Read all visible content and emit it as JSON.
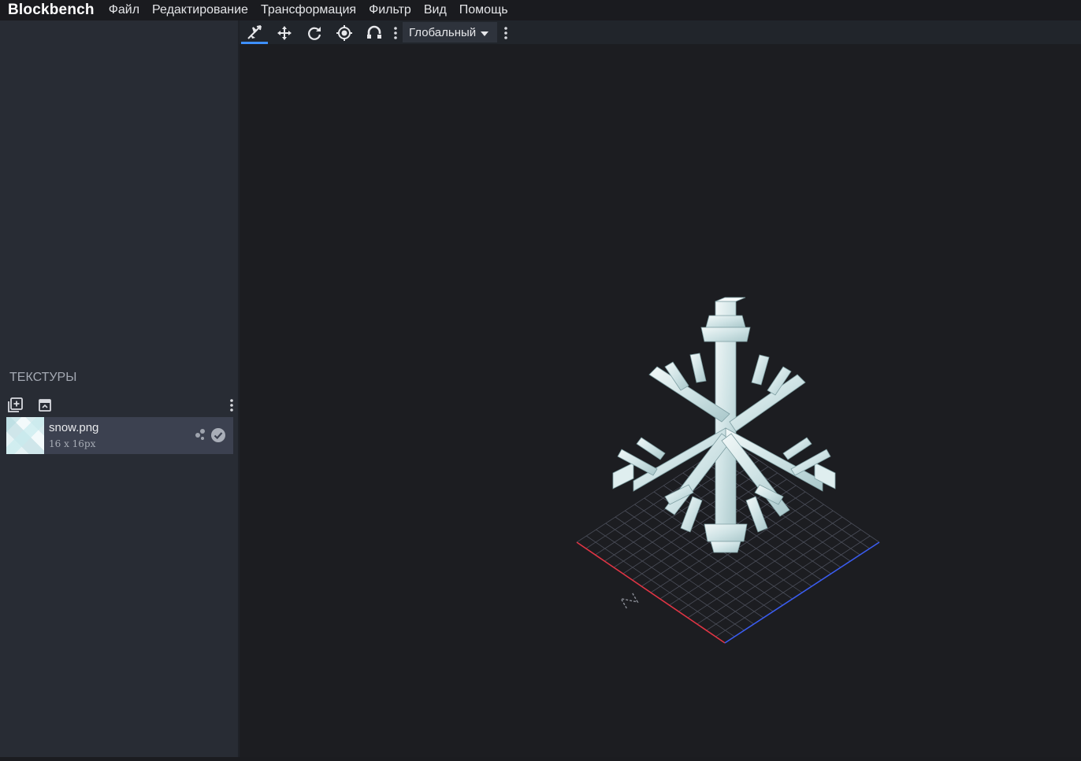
{
  "app": {
    "name": "Blockbench"
  },
  "menu": [
    "Файл",
    "Редактирование",
    "Трансформация",
    "Фильтр",
    "Вид",
    "Помощь"
  ],
  "toolbar": {
    "tools": [
      "move-tool-icon",
      "resize-tool-icon",
      "rotate-tool-icon",
      "pivot-tool-icon",
      "vertex-snap-icon"
    ],
    "space_select": "Глобальный"
  },
  "textures_panel": {
    "title": "ТЕКСТУРЫ",
    "items": [
      {
        "name": "snow.png",
        "size": "16 x 16px"
      }
    ]
  },
  "viewport": {
    "compass_label": "N"
  },
  "colors": {
    "accent": "#3e90ff",
    "x_axis": "#e03444",
    "z_axis": "#3a5cf0"
  }
}
